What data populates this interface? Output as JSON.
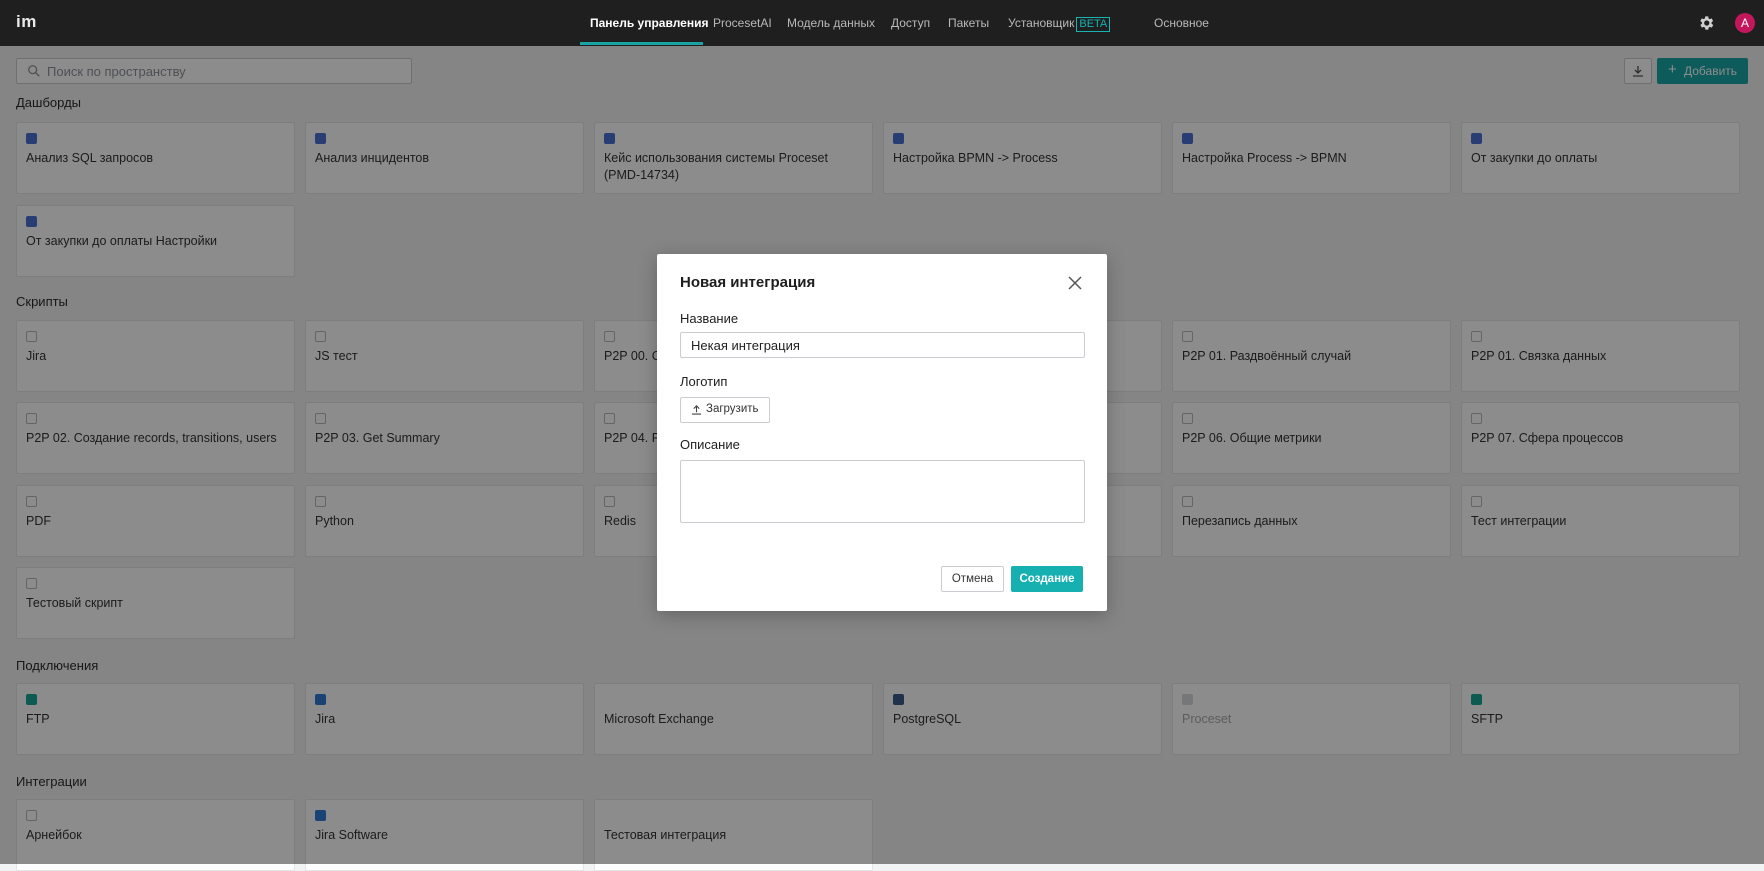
{
  "app": {
    "logo": "im"
  },
  "nav": {
    "items": [
      {
        "label": "Панель управления",
        "active": true
      },
      {
        "label": "ProcesetAI"
      },
      {
        "label": "Модель данных"
      },
      {
        "label": "Доступ"
      },
      {
        "label": "Пакеты"
      },
      {
        "label": "Установщик"
      },
      {
        "label": "Основное"
      }
    ],
    "beta_badge": "BETA"
  },
  "user": {
    "avatar_letter": "А",
    "avatar_color": "#c2185b"
  },
  "toolbar": {
    "search_placeholder": "Поиск по пространству",
    "add_label": "Добавить",
    "accent": "#1aa6a6"
  },
  "sections": {
    "dashboards": {
      "title": "Дашборды",
      "items": [
        "Анализ SQL запросов",
        "Анализ инцидентов",
        "Кейс использования системы Proceset (PMD-14734)",
        "Настройка BPMN -> Process",
        "Настройка Process -> BPMN",
        "От закупки до оплаты",
        "От закупки до оплаты Настройки"
      ]
    },
    "scripts": {
      "title": "Скрипты",
      "items": [
        "Jira",
        "JS тест",
        "P2P 00. С...",
        "",
        "P2P 01. Раздвоённый случай",
        "P2P 01. Связка данных",
        "P2P 02. Создание records, transitions, users",
        "P2P 03. Get Summary",
        "P2P 04. Р...",
        "",
        "P2P 06. Общие метрики",
        "P2P 07. Сфера процессов",
        "PDF",
        "Python",
        "Redis",
        "",
        "Перезапись данных",
        "Тест интеграции",
        "Тестовый скрипт"
      ]
    },
    "connections": {
      "title": "Подключения",
      "items": [
        "FTP",
        "Jira",
        "Microsoft Exchange",
        "PostgreSQL",
        "Proceset",
        "SFTP"
      ]
    },
    "integrations": {
      "title": "Интеграции",
      "items": [
        "Арнейбок",
        "Jira Software",
        "Тестовая интеграция"
      ]
    }
  },
  "modal": {
    "title": "Новая интеграция",
    "name_label": "Название",
    "name_value": "Некая интеграция",
    "logo_label": "Логотип",
    "upload_label": "Загрузить",
    "description_label": "Описание",
    "description_value": "",
    "cancel_label": "Отмена",
    "create_label": "Создание"
  }
}
